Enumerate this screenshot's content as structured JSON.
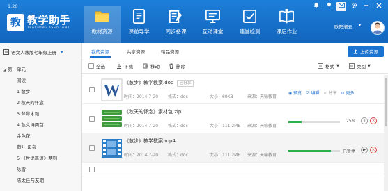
{
  "app": {
    "version": "1.20",
    "title": "教学助手",
    "subtitle": "TEACHING ASSISTANT",
    "logo_char": "教"
  },
  "nav": {
    "tabs": [
      {
        "label": "教材资源",
        "icon": "folder-icon",
        "active": true
      },
      {
        "label": "课前导学",
        "icon": "notebook-icon",
        "active": false
      },
      {
        "label": "同步备课",
        "icon": "book-edit-icon",
        "active": false
      },
      {
        "label": "互动课堂",
        "icon": "monitor-icon",
        "active": false
      },
      {
        "label": "随堂检测",
        "icon": "checkbox-icon",
        "active": false
      },
      {
        "label": "课后作业",
        "icon": "book-open-icon",
        "active": false
      }
    ]
  },
  "window_controls": {
    "icons": [
      "bell-icon",
      "pin-icon",
      "message-icon",
      "settings-icon",
      "minimize-icon",
      "close-icon"
    ]
  },
  "user": {
    "name": "欧阳淑云",
    "status_icon": "chevron-icon"
  },
  "sidebar": {
    "book": "语文人教版七年级上册",
    "items": [
      {
        "label": "第一单元",
        "level": "unit"
      },
      {
        "label": "阅读",
        "level": "child"
      },
      {
        "label": "1   散步",
        "level": "child"
      },
      {
        "label": "2   秋天的怀念",
        "level": "child"
      },
      {
        "label": "3   斧斧木颗",
        "level": "child"
      },
      {
        "label": "4   散文诗两首",
        "level": "child"
      },
      {
        "label": "金色花",
        "level": "child"
      },
      {
        "label": "荷叶  母亲",
        "level": "child"
      },
      {
        "label": "5   《世说新语》两则",
        "level": "child"
      },
      {
        "label": "咏雪",
        "level": "child"
      },
      {
        "label": "陈太丘与友期",
        "level": "child"
      }
    ]
  },
  "subtabs": {
    "items": [
      {
        "label": "我的资源",
        "active": true
      },
      {
        "label": "共享资源",
        "active": false
      },
      {
        "label": "精品资源",
        "active": false
      }
    ],
    "upload_label": "上传资源"
  },
  "toolbar": {
    "select_all": "全选",
    "download": "下载",
    "move": "移动",
    "delete": "删除",
    "format": "格式",
    "category": "类别"
  },
  "files": [
    {
      "icon": "word-doc-icon",
      "title": "《散步》教学教案.doc",
      "shared_tag": "已分享",
      "time": "时间：2014-7-20",
      "format": "格式：doc",
      "size": "大小：69KB",
      "source": "来源：天喻教育",
      "actions": {
        "preview": "预览",
        "edit": "编辑",
        "share": "分享",
        "more": "更多"
      }
    },
    {
      "icon": "zip-archive-icon",
      "title": "《秋天的怀念》素材包.zip",
      "time": "时间：2014-7-20",
      "format": "格式：doc",
      "size": "大小：111.2MB",
      "source": "来源：天喻教育",
      "progress": 0.25,
      "progress_text": "25%",
      "state": "downloading"
    },
    {
      "icon": "video-file-icon",
      "title": "《散步》教学教案.mp4",
      "time": "时间：2014-7-20",
      "format": "格式：doc",
      "size": "大小：111.2MB",
      "source": "来源：天喻教育",
      "progress": 0.82,
      "progress_text": "已暂停",
      "state": "paused"
    }
  ],
  "colors": {
    "header": "#1670cc",
    "accent": "#1a73d1",
    "progress": "#29b34a",
    "word_blue": "#2b5797",
    "zip_green": "#3f9a3c",
    "video_blue": "#2c7ec9"
  }
}
